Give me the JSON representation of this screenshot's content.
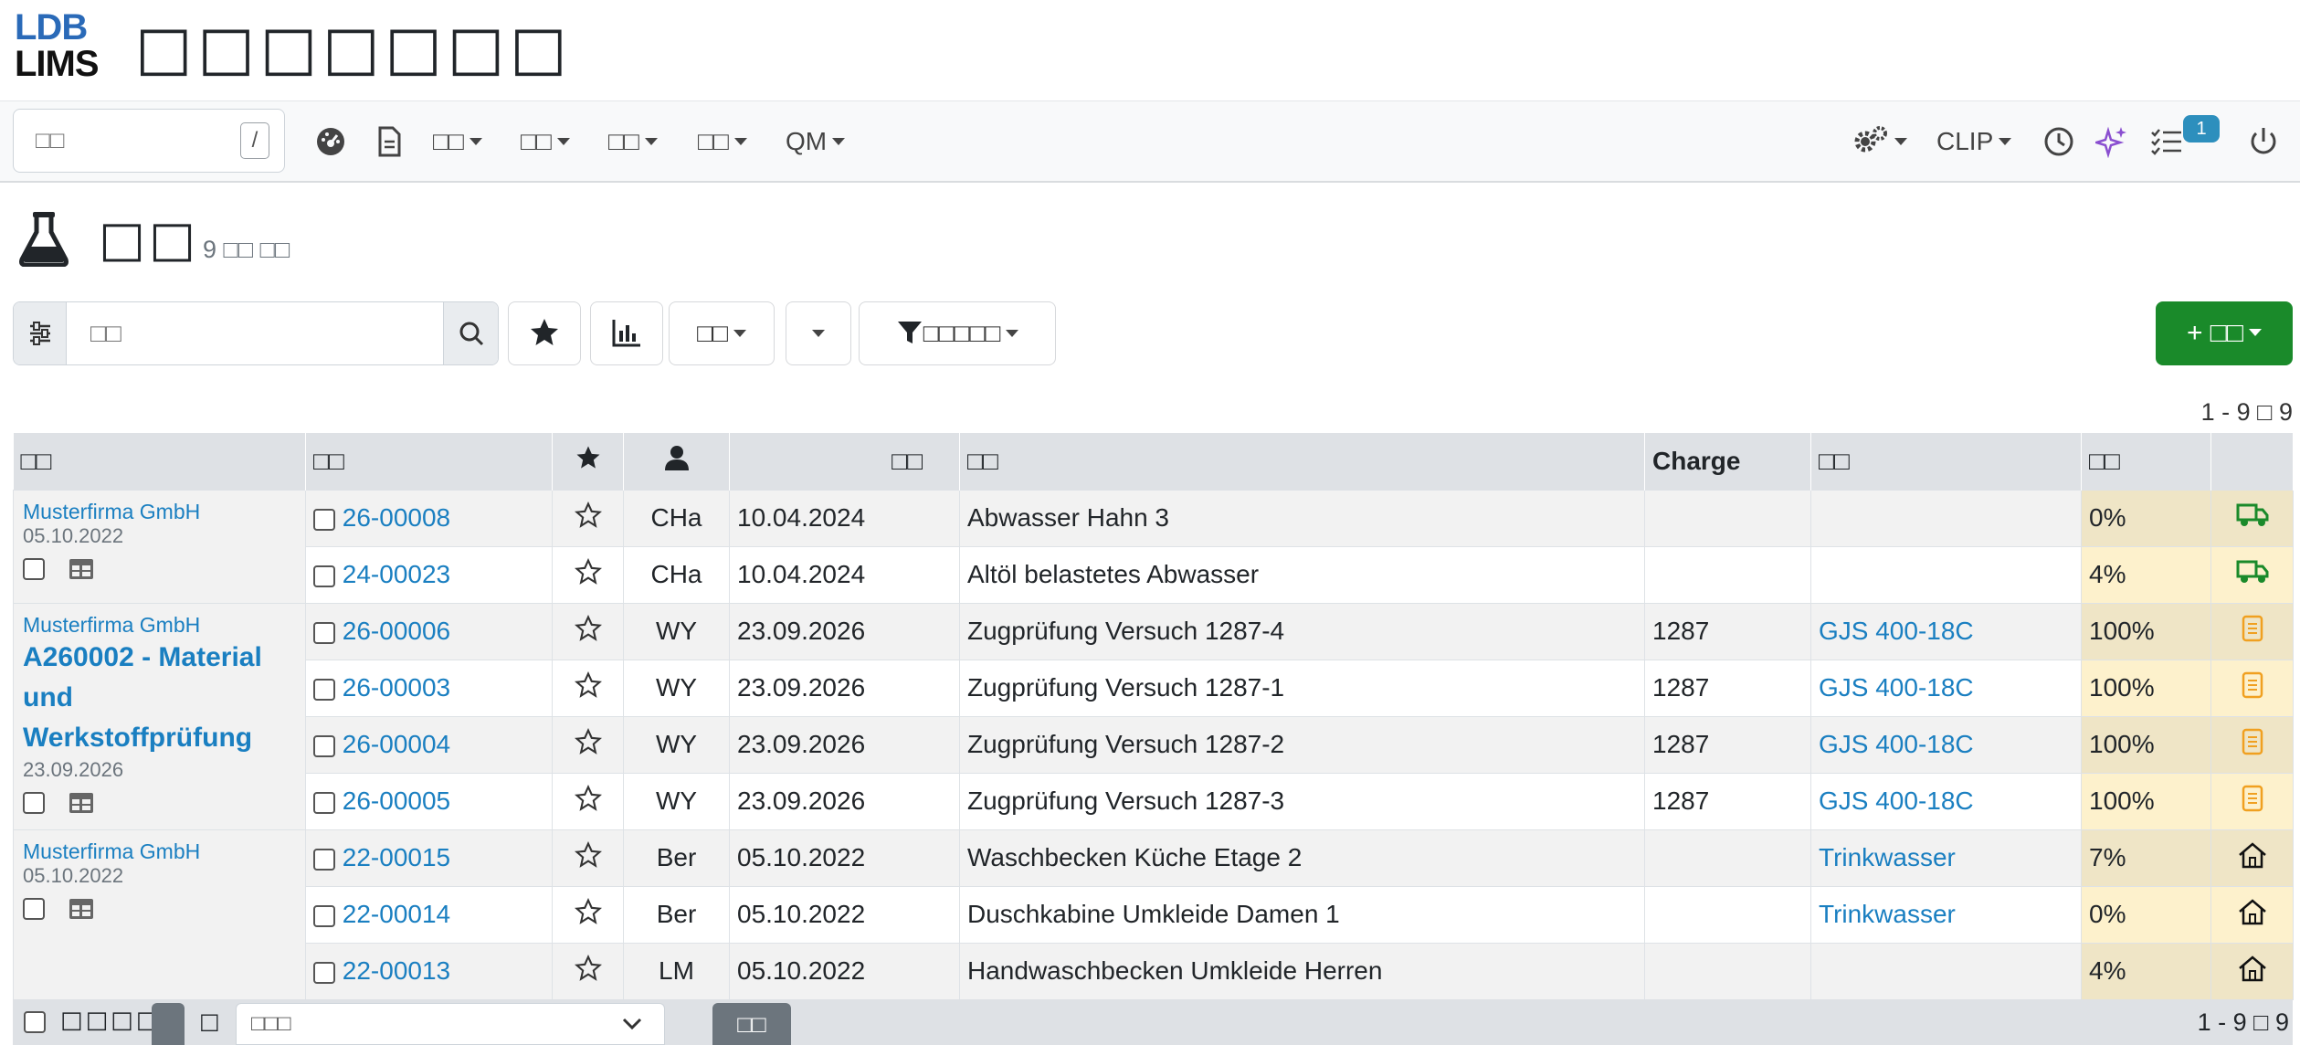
{
  "app": {
    "logo_line1": "LDB",
    "logo_line2": "LIMS",
    "title": "□□□□□□□"
  },
  "nav": {
    "search_placeholder": "□□",
    "search_shortcut": "/",
    "menus": [
      "□□",
      "□□",
      "□□",
      "□□",
      "QM"
    ],
    "clip_label": "CLIP",
    "tasks_badge": "1"
  },
  "page": {
    "title": "□□",
    "subtitle": "9 □□ □□"
  },
  "toolbar": {
    "search_placeholder": "□□",
    "view_label": "□□",
    "filter_label": "□□□□□",
    "new_label": "+ □□"
  },
  "pager_text": "1 - 9 □ 9",
  "table": {
    "headers": {
      "group": "□□",
      "number": "□□",
      "date": "□□",
      "description": "□□",
      "charge": "Charge",
      "type": "□□",
      "progress": "□□"
    },
    "groups": [
      {
        "customer": "Musterfirma GmbH",
        "title": "",
        "date": "05.10.2022"
      },
      {
        "customer": "Musterfirma GmbH",
        "title": "A260002 - Material und Werkstoffprüfung",
        "date": "23.09.2026"
      },
      {
        "customer": "Musterfirma GmbH",
        "title": "",
        "date": "05.10.2022"
      }
    ],
    "rows": [
      {
        "number": "26-00008",
        "user": "CHa",
        "date": "10.04.2024",
        "description": "Abwasser Hahn 3",
        "charge": "",
        "type": "",
        "progress": "0%",
        "status_icon": "truck-icon"
      },
      {
        "number": "24-00023",
        "user": "CHa",
        "date": "10.04.2024",
        "description": "Altöl belastetes Abwasser",
        "charge": "",
        "type": "",
        "progress": "4%",
        "status_icon": "truck-icon"
      },
      {
        "number": "26-00006",
        "user": "WY",
        "date": "23.09.2026",
        "description": "Zugprüfung Versuch 1287-4",
        "charge": "1287",
        "type": "GJS 400-18C",
        "progress": "100%",
        "status_icon": "document-icon"
      },
      {
        "number": "26-00003",
        "user": "WY",
        "date": "23.09.2026",
        "description": "Zugprüfung Versuch 1287-1",
        "charge": "1287",
        "type": "GJS 400-18C",
        "progress": "100%",
        "status_icon": "document-icon"
      },
      {
        "number": "26-00004",
        "user": "WY",
        "date": "23.09.2026",
        "description": "Zugprüfung Versuch 1287-2",
        "charge": "1287",
        "type": "GJS 400-18C",
        "progress": "100%",
        "status_icon": "document-icon"
      },
      {
        "number": "26-00005",
        "user": "WY",
        "date": "23.09.2026",
        "description": "Zugprüfung Versuch 1287-3",
        "charge": "1287",
        "type": "GJS 400-18C",
        "progress": "100%",
        "status_icon": "document-icon"
      },
      {
        "number": "22-00015",
        "user": "Ber",
        "date": "05.10.2022",
        "description": "Waschbecken Küche Etage 2",
        "charge": "",
        "type": "Trinkwasser",
        "progress": "7%",
        "status_icon": "house-icon"
      },
      {
        "number": "22-00014",
        "user": "Ber",
        "date": "05.10.2022",
        "description": "Duschkabine Umkleide Damen 1",
        "charge": "",
        "type": "Trinkwasser",
        "progress": "0%",
        "status_icon": "house-icon"
      },
      {
        "number": "22-00013",
        "user": "LM",
        "date": "05.10.2022",
        "description": "Handwaschbecken Umkleide Herren",
        "charge": "",
        "type": "",
        "progress": "4%",
        "status_icon": "house-icon"
      }
    ]
  },
  "footer": {
    "select_all_label": "□□□□",
    "sep": "□",
    "select_placeholder": "□□□",
    "apply_label": "□□",
    "pager_text": "1 - 9 □ 9"
  },
  "colors": {
    "accent": "#1a7fc1",
    "success": "#1a8a2a",
    "warning": "#f0a020",
    "badge": "#2d8fbd"
  }
}
